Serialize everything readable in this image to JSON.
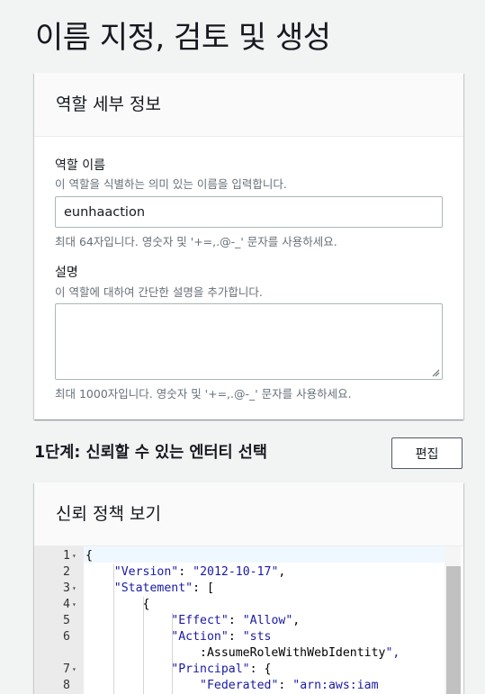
{
  "page": {
    "title": "이름 지정, 검토 및 생성"
  },
  "role_details": {
    "header": "역할 세부 정보",
    "name_label": "역할 이름",
    "name_description": "이 역할을 식별하는 의미 있는 이름을 입력합니다.",
    "name_value": "eunhaaction",
    "name_hint": "최대 64자입니다. 영숫자 및 '+=,.@-_' 문자를 사용하세요.",
    "desc_label": "설명",
    "desc_description": "이 역할에 대하여 간단한 설명을 추가합니다.",
    "desc_value": "",
    "desc_hint": "최대 1000자입니다. 영숫자 및 '+=,.@-_' 문자를 사용하세요."
  },
  "step1": {
    "title": "1단계: 신뢰할 수 있는 엔터티 선택",
    "edit_label": "편집"
  },
  "trust_policy": {
    "header": "신뢰 정책 보기",
    "lines": [
      {
        "n": "1",
        "fold": true,
        "text": "{"
      },
      {
        "n": "2",
        "fold": false,
        "text": "    \"Version\": \"2012-10-17\","
      },
      {
        "n": "3",
        "fold": true,
        "text": "    \"Statement\": ["
      },
      {
        "n": "4",
        "fold": true,
        "text": "        {"
      },
      {
        "n": "5",
        "fold": false,
        "text": "            \"Effect\": \"Allow\","
      },
      {
        "n": "6",
        "fold": false,
        "text": "            \"Action\": \"sts"
      },
      {
        "n": "",
        "fold": false,
        "text": "                :AssumeRoleWithWebIdentity\","
      },
      {
        "n": "7",
        "fold": true,
        "text": "            \"Principal\": {"
      },
      {
        "n": "8",
        "fold": false,
        "text": "                \"Federated\": \"arn:aws:iam"
      }
    ]
  }
}
